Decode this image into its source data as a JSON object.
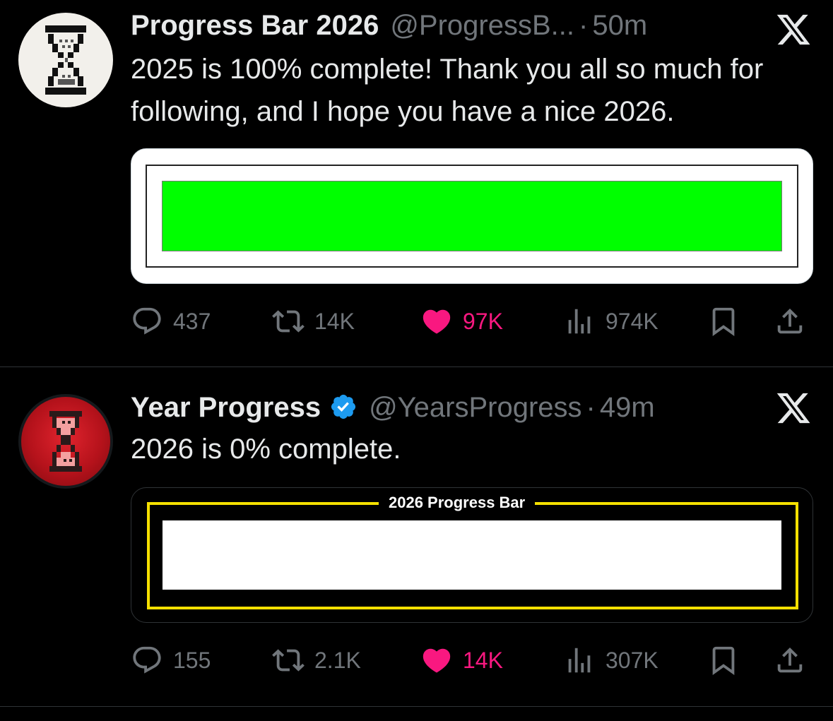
{
  "tweets": [
    {
      "name": "Progress Bar 2026",
      "verified": false,
      "handle": "@ProgressB...",
      "separator": "·",
      "time": "50m",
      "text": "2025 is 100% complete! Thank you all so much for following, and I hope you have a nice 2026.",
      "media": {
        "type": "progress-bar",
        "label": "",
        "progress_fraction": 1.0,
        "fill_color": "#00ff00"
      },
      "actions": {
        "replies": "437",
        "reposts": "14K",
        "likes": "97K",
        "views": "974K"
      },
      "liked": true
    },
    {
      "name": "Year Progress",
      "verified": true,
      "handle": "@YearsProgress",
      "separator": "·",
      "time": "49m",
      "text": "2026 is 0% complete.",
      "media": {
        "type": "progress-bar",
        "label": "2026 Progress Bar",
        "progress_fraction": 0.0,
        "frame_color": "#f5e000"
      },
      "actions": {
        "replies": "155",
        "reposts": "2.1K",
        "likes": "14K",
        "views": "307K"
      },
      "liked": true
    }
  ],
  "icons": {
    "reply": "speech-bubble-icon",
    "repost": "repost-arrows-icon",
    "like": "heart-icon",
    "views": "bar-chart-icon",
    "bookmark": "bookmark-icon",
    "share": "share-upload-icon",
    "platform": "x-logo-icon",
    "verified": "verified-badge-icon",
    "avatar": "hourglass-icon"
  },
  "colors": {
    "background": "#000000",
    "text": "#e7e9ea",
    "muted": "#71767b",
    "like": "#f91880",
    "verified": "#1d9bf0"
  }
}
